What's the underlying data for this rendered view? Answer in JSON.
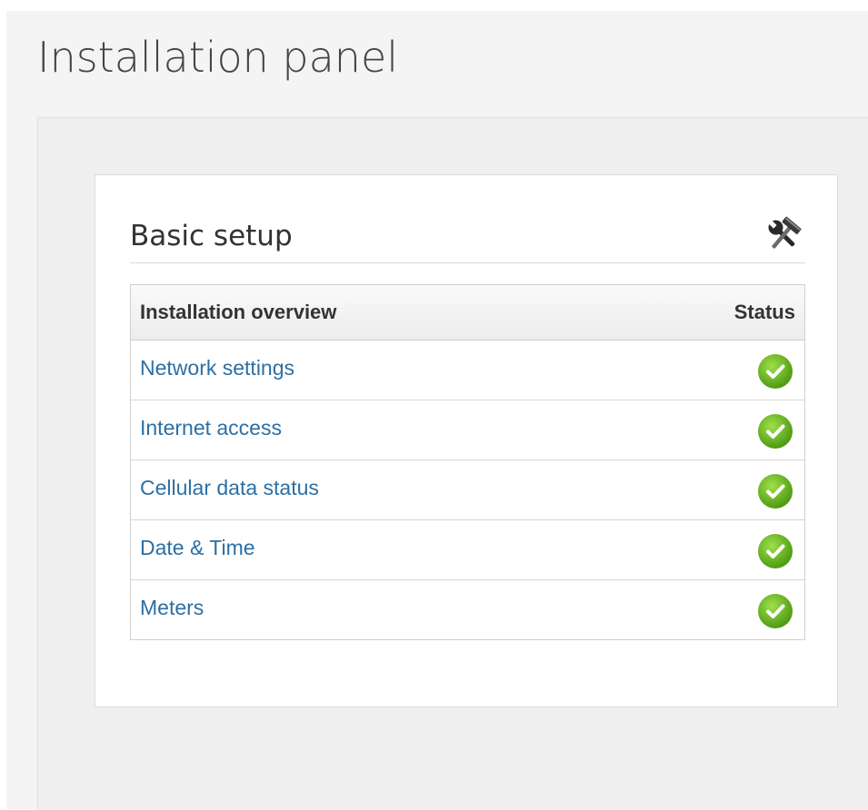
{
  "page": {
    "title": "Installation panel"
  },
  "card": {
    "title": "Basic setup",
    "header_icon": "tools-icon"
  },
  "table": {
    "headers": {
      "overview": "Installation overview",
      "status": "Status"
    },
    "rows": [
      {
        "label": "Network settings",
        "status": "ok"
      },
      {
        "label": "Internet access",
        "status": "ok"
      },
      {
        "label": "Cellular data status",
        "status": "ok"
      },
      {
        "label": "Date & Time",
        "status": "ok"
      },
      {
        "label": "Meters",
        "status": "ok"
      }
    ]
  },
  "colors": {
    "link": "#2d6fa3",
    "status_ok": "#6cbb1e",
    "page_background": "#f4f4f4"
  },
  "icons": {
    "status_ok": "check-circle-icon"
  }
}
